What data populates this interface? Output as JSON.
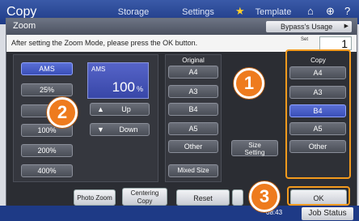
{
  "topbar": {
    "title": "Copy",
    "tabs": [
      "Storage",
      "Settings",
      "Template"
    ],
    "icons": [
      "star-icon",
      "home-icon",
      "globe-icon",
      "help-icon"
    ]
  },
  "dialog": {
    "title": "Zoom",
    "bypass_label": "Bypass's Usage",
    "message": "After setting the Zoom Mode, please press the OK button.",
    "set_label": "Set",
    "set_value": "1"
  },
  "left_buttons": {
    "ams": "AMS",
    "p25": "25%",
    "p100": "100%",
    "p200": "200%",
    "p400": "400%"
  },
  "ams_display": {
    "label": "AMS",
    "value": "100",
    "unit": "%"
  },
  "updown": {
    "up": "Up",
    "down": "Down"
  },
  "original": {
    "heading": "Original",
    "items": [
      "A4",
      "A3",
      "B4",
      "A5",
      "Other"
    ],
    "mixed": "Mixed Size"
  },
  "size_setting": {
    "line1": "Size",
    "line2": "Setting"
  },
  "copy": {
    "heading": "Copy",
    "items": [
      "A4",
      "A3",
      "B4",
      "A5",
      "Other"
    ],
    "selected": "B4"
  },
  "bottom": {
    "photo_zoom": "Photo Zoom",
    "centering_line1": "Centering",
    "centering_line2": "Copy",
    "reset": "Reset",
    "ok": "OK"
  },
  "callouts": [
    "1",
    "2",
    "3"
  ],
  "status": {
    "time": "08:43",
    "job_status": "Job Status"
  },
  "colors": {
    "accent_orange": "#EE7B1E",
    "selected_blue": "#3A4FB8"
  }
}
